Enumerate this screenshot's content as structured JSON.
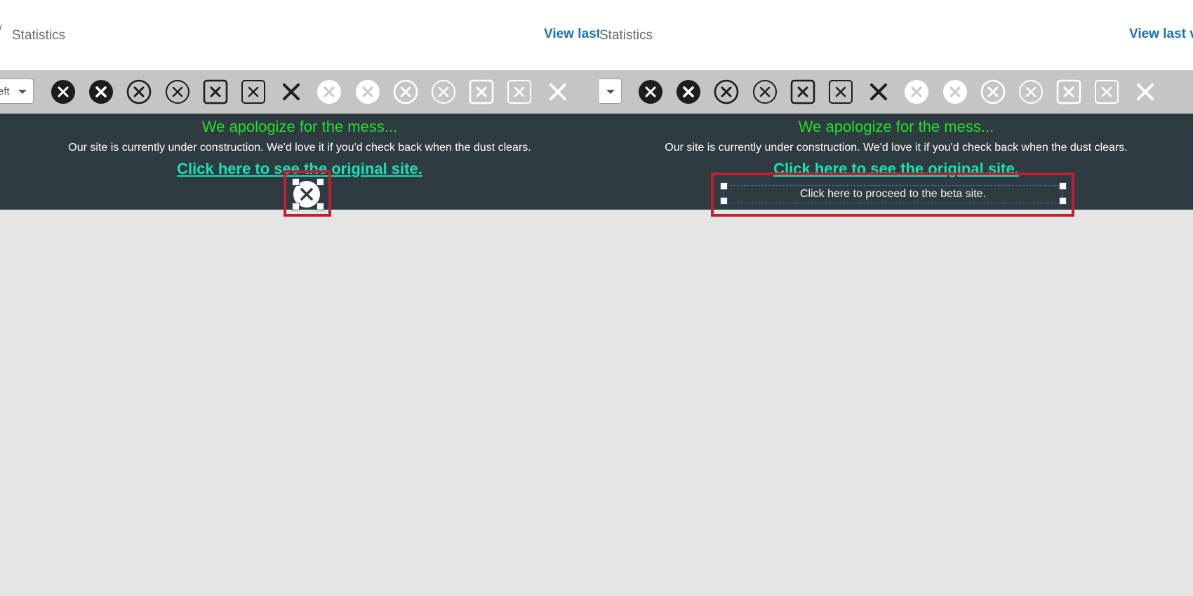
{
  "left_pane": {
    "header": {
      "title": "Statistics",
      "view_last": "View last"
    },
    "toolbar": {
      "align_select_value": "eft"
    },
    "banner": {
      "apology": "We apologize for the mess...",
      "message": "Our site is currently under construction. We'd love it if you'd check back when the dust clears.",
      "original_link": "Click here to see the original site."
    }
  },
  "right_pane": {
    "header": {
      "title": "Statistics",
      "view_last": "View last v"
    },
    "toolbar": {
      "align_select_value": ""
    },
    "banner": {
      "apology": "We apologize for the mess...",
      "message": "Our site is currently under construction. We'd love it if you'd check back when the dust clears.",
      "original_link": "Click here to see the original site.",
      "beta_link": "Click here to proceed to the beta site."
    }
  },
  "icon_styles": [
    "close-circle-filled-dark",
    "close-circle-filled-dark-bold",
    "close-circle-outline-dark",
    "close-circle-outline-dark-thin",
    "close-square-outline-dark",
    "close-square-outline-dark-thin",
    "close-x-dark",
    "close-circle-filled-white",
    "close-circle-filled-white-thin",
    "close-circle-outline-white",
    "close-circle-outline-white-thin",
    "close-square-outline-white",
    "close-square-outline-white-thin",
    "close-x-white"
  ],
  "colors": {
    "banner_bg": "#2e3b40",
    "apology_text": "#22e02c",
    "link_text": "#18e0b8",
    "header_link": "#1a73b6",
    "highlight_box": "#c0202e",
    "toolbar_bg": "#c5c5c5",
    "canvas_bg": "#e6e5e6"
  }
}
